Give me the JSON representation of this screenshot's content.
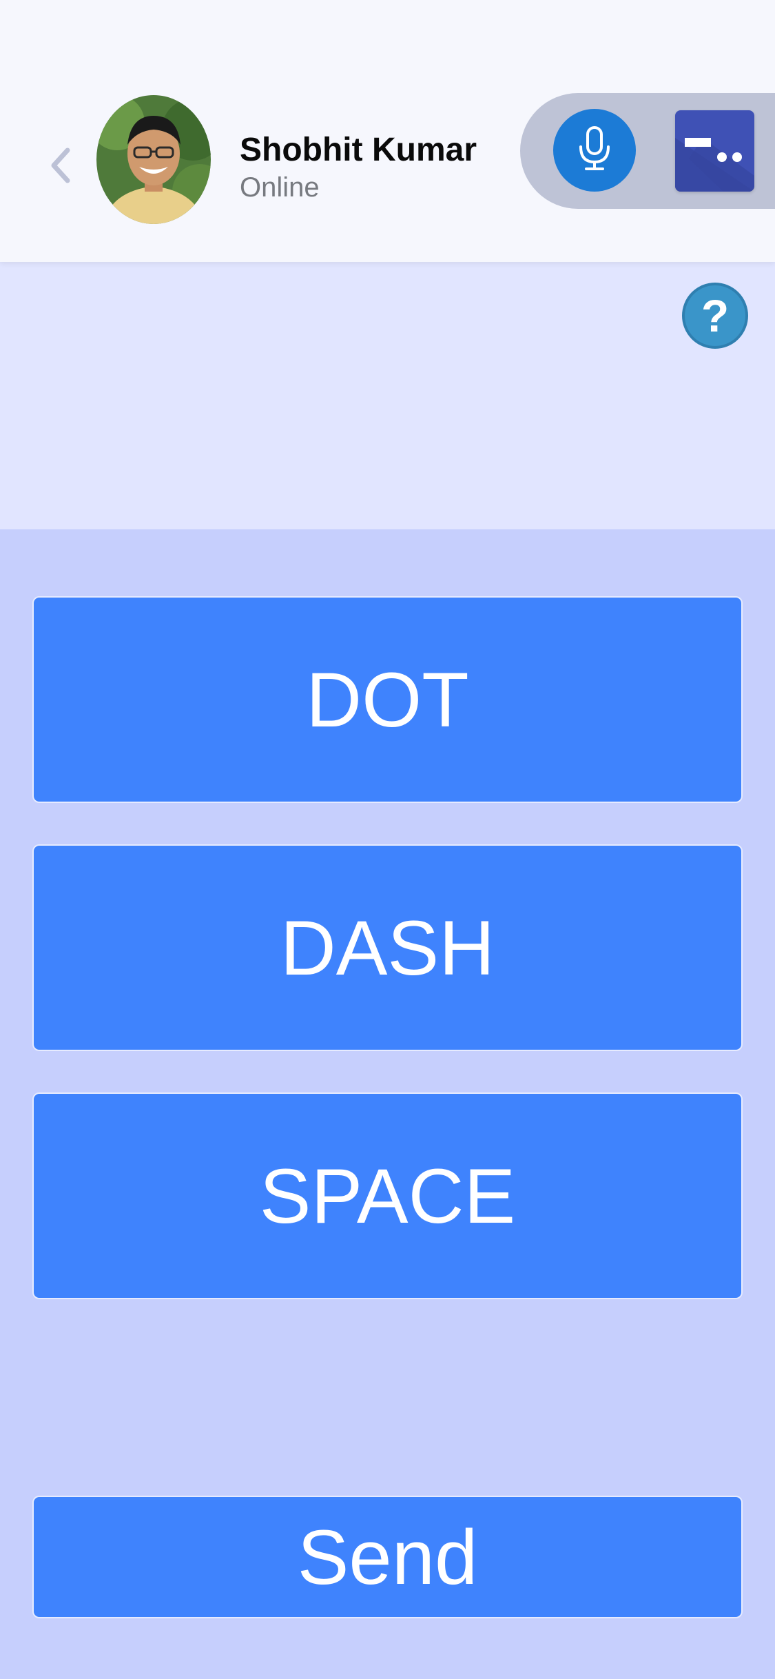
{
  "header": {
    "contact_name": "Shobhit Kumar",
    "contact_status": "Online",
    "icons": {
      "back": "chevron-left-icon",
      "avatar": "profile-photo",
      "mic": "microphone-icon",
      "morse": "morse-code-icon"
    },
    "colors": {
      "mic_bg": "#1c7bd6",
      "morse_bg": "#3f51b5",
      "pill_bg": "#bec3d6"
    }
  },
  "help": {
    "label": "?",
    "color": "#3a95c9"
  },
  "keys": {
    "dot_label": "DOT",
    "dash_label": "DASH",
    "space_label": "SPACE"
  },
  "send": {
    "label": "Send"
  },
  "colors": {
    "button": "#3f83fd",
    "page_bg": "#c6cffd",
    "info_bg": "#e1e5ff"
  }
}
